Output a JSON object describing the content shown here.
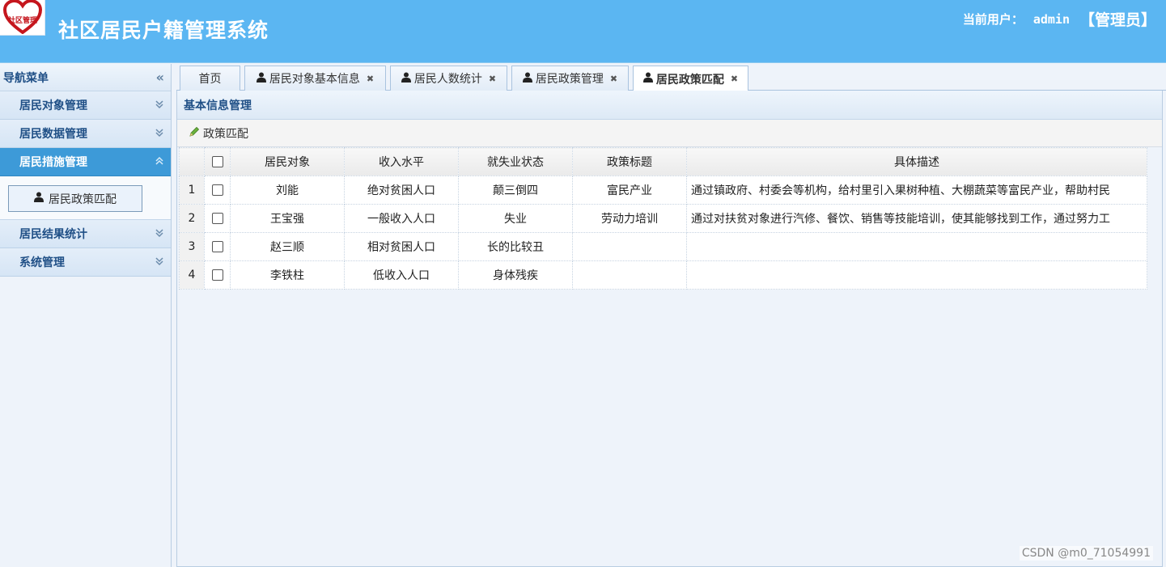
{
  "app": {
    "logo_text": "社区管理",
    "title": "社区居民户籍管理系统",
    "user_label": "当前用户：",
    "user_name": "admin",
    "user_role": "【管理员】"
  },
  "colors": {
    "header_bg": "#5bb6f2",
    "active_nav_bg": "#3d9ad8",
    "logo_heart": "#c5161d"
  },
  "sidebar": {
    "header": "导航菜单",
    "groups": [
      {
        "label": "居民对象管理",
        "icon": "chevron-down-icon"
      },
      {
        "label": "居民数据管理",
        "icon": "chevron-down-icon"
      },
      {
        "label": "居民措施管理",
        "icon": "chevron-up-icon",
        "expanded": true,
        "items": [
          {
            "label": "居民政策匹配",
            "icon": "user-icon"
          }
        ]
      },
      {
        "label": "居民结果统计",
        "icon": "chevron-down-icon"
      },
      {
        "label": "系统管理",
        "icon": "chevron-down-icon"
      }
    ]
  },
  "tabs": [
    {
      "label": "首页",
      "closable": false
    },
    {
      "label": "居民对象基本信息",
      "closable": true,
      "icon": "user-icon"
    },
    {
      "label": "居民人数统计",
      "closable": true,
      "icon": "user-icon"
    },
    {
      "label": "居民政策管理",
      "closable": true,
      "icon": "user-icon"
    },
    {
      "label": "居民政策匹配",
      "closable": true,
      "icon": "user-icon",
      "active": true
    }
  ],
  "panel": {
    "title": "基本信息管理",
    "toolbar": {
      "match_label": "政策匹配",
      "match_icon": "pencil-icon"
    }
  },
  "table": {
    "columns": [
      "居民对象",
      "收入水平",
      "就失业状态",
      "政策标题",
      "具体描述"
    ],
    "rows": [
      {
        "num": "1",
        "cells": [
          "刘能",
          "绝对贫困人口",
          "颠三倒四",
          "富民产业",
          "通过镇政府、村委会等机构，给村里引入果树种植、大棚蔬菜等富民产业，帮助村民"
        ]
      },
      {
        "num": "2",
        "cells": [
          "王宝强",
          "一般收入人口",
          "失业",
          "劳动力培训",
          "通过对扶贫对象进行汽修、餐饮、销售等技能培训，使其能够找到工作，通过努力工"
        ]
      },
      {
        "num": "3",
        "cells": [
          "赵三顺",
          "相对贫困人口",
          "长的比较丑",
          "",
          ""
        ]
      },
      {
        "num": "4",
        "cells": [
          "李铁柱",
          "低收入人口",
          "身体残疾",
          "",
          ""
        ]
      }
    ]
  },
  "watermark": "CSDN @m0_71054991"
}
